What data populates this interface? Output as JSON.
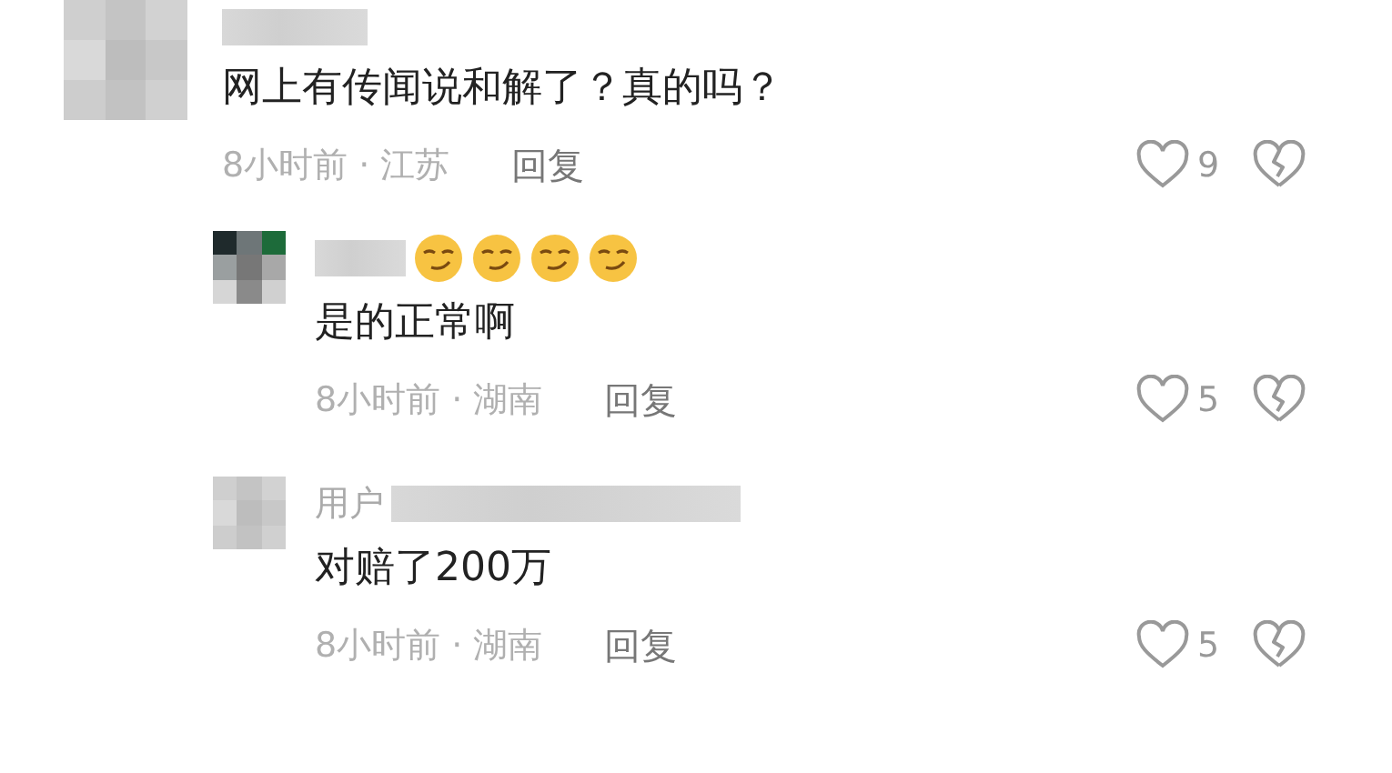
{
  "comment": {
    "text": "网上有传闻说和解了？真的吗？",
    "meta": "8小时前 · 江苏",
    "reply": "回复",
    "likes": "9",
    "liked": false,
    "replies": [
      {
        "emojis": [
          {
            "kind": "smirk"
          },
          {
            "kind": "smirk"
          },
          {
            "kind": "smirk"
          },
          {
            "kind": "smirk"
          }
        ],
        "text": "是的正常啊",
        "meta": "8小时前 · 湖南",
        "reply": "回复",
        "likes": "5",
        "liked": false
      },
      {
        "user_prefix": "用户",
        "text": "对赔了200万",
        "meta": "8小时前 · 湖南",
        "reply": "回复",
        "likes": "5",
        "liked": false
      }
    ]
  }
}
